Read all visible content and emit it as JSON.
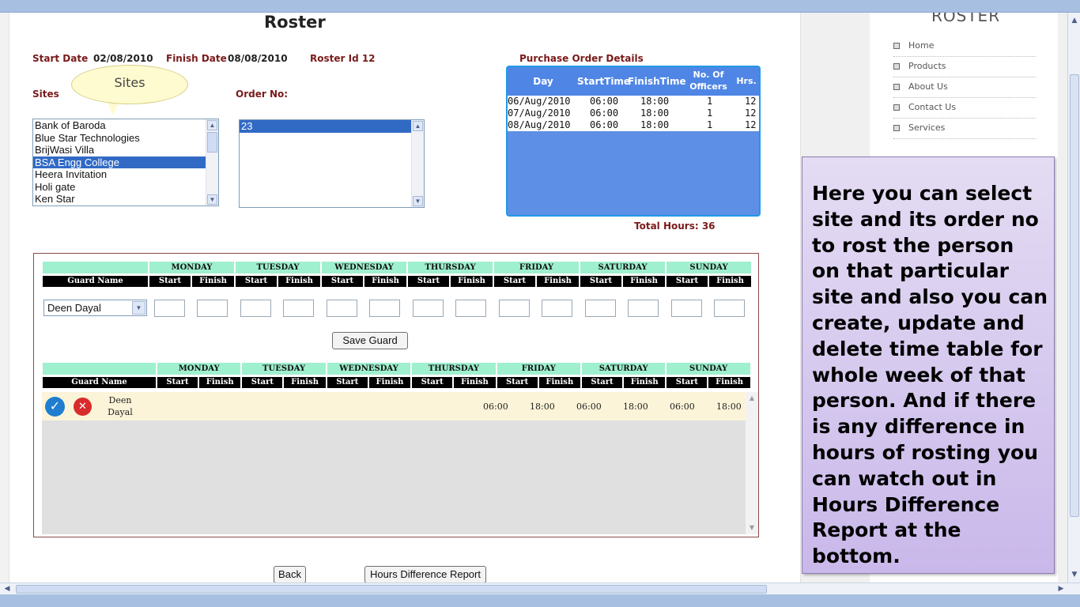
{
  "page": {
    "title": "Roster"
  },
  "info": {
    "start_label": "Start Date",
    "start_value": "02/08/2010",
    "finish_label": "Finish Date",
    "finish_value": "08/08/2010",
    "roster_id_label": "Roster Id 12"
  },
  "sites": {
    "label": "Sites",
    "tooltip": "Sites",
    "options": [
      "Bank of Baroda",
      "Blue Star Technologies",
      "BrijWasi Villa",
      "BSA Engg College",
      "Heera Invitation",
      "Holi gate",
      "Ken Star"
    ],
    "selected_index": 3
  },
  "order": {
    "label": "Order No:",
    "options": [
      "23"
    ],
    "selected_index": 0
  },
  "purchase_order": {
    "title": "Purchase Order Details",
    "headers": {
      "day": "Day",
      "start": "StartTime",
      "finish": "FinishTime",
      "officers_1": "No. Of",
      "officers_2": "Officers",
      "hrs": "Hrs."
    },
    "rows": [
      {
        "day": "06/Aug/2010",
        "start": "06:00",
        "finish": "18:00",
        "officers": "1",
        "hrs": "12"
      },
      {
        "day": "07/Aug/2010",
        "start": "06:00",
        "finish": "18:00",
        "officers": "1",
        "hrs": "12"
      },
      {
        "day": "08/Aug/2010",
        "start": "06:00",
        "finish": "18:00",
        "officers": "1",
        "hrs": "12"
      }
    ],
    "total_hours": "Total Hours: 36"
  },
  "schedule": {
    "guard_name_header": "Guard Name",
    "start_header": "Start",
    "finish_header": "Finish",
    "days": [
      "MONDAY",
      "TUESDAY",
      "WEDNESDAY",
      "THURSDAY",
      "FRIDAY",
      "SATURDAY",
      "SUNDAY"
    ],
    "selected_guard": "Deen Dayal",
    "save_button": "Save Guard"
  },
  "results": {
    "guard_name_line1": "Deen",
    "guard_name_line2": "Dayal",
    "times": [
      "06:00",
      "18:00",
      "06:00",
      "18:00",
      "06:00",
      "18:00"
    ]
  },
  "buttons": {
    "back": "Back",
    "hours_report": "Hours Difference Report"
  },
  "side_menu": {
    "title": "ROSTER",
    "items": [
      "Home",
      "Products",
      "About Us",
      "Contact Us",
      "Services"
    ]
  },
  "callout": {
    "text": "Here you can select site and its order no to rost the person on that particular site and also you can create, update and delete time table for whole week of that person. And if there is any difference in hours of rosting you can watch out in Hours Difference Report at the bottom."
  },
  "icons": {
    "save": "checkmark-icon",
    "delete": "delete-icon"
  }
}
